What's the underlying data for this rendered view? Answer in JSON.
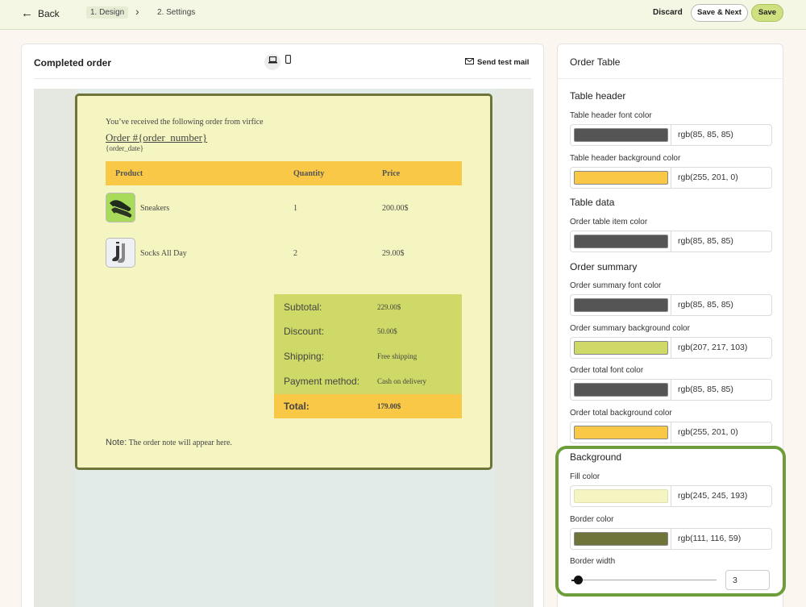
{
  "topbar": {
    "back_label": "Back",
    "step1_label": "1. Design",
    "step2_label": "2. Settings",
    "discard_label": "Discard",
    "save_next_label": "Save & Next",
    "save_label": "Save"
  },
  "preview": {
    "title": "Completed order",
    "send_test_label": "Send test mail"
  },
  "email": {
    "intro": "You’ve received the following order from virfice",
    "order_number": "Order #{order_number}",
    "order_date": "{order_date}",
    "table_headers": {
      "product": "Product",
      "quantity": "Quantity",
      "price": "Price"
    },
    "items": [
      {
        "name": "Sneakers",
        "qty": "1",
        "price": "200.00$"
      },
      {
        "name": "Socks All Day",
        "qty": "2",
        "price": "29.00$"
      }
    ],
    "summary": [
      {
        "label": "Subtotal:",
        "value": "229.00$"
      },
      {
        "label": "Discount:",
        "value": "50.00$"
      },
      {
        "label": "Shipping:",
        "value": "Free shipping"
      },
      {
        "label": "Payment method:",
        "value": "Cash on delivery"
      }
    ],
    "total_label": "Total:",
    "total_value": "179.00$",
    "note_label": "Note:",
    "note_text": " The order note will appear here."
  },
  "panel": {
    "title": "Order Table",
    "sections": {
      "table_header": "Table header",
      "table_data": "Table data",
      "order_summary": "Order summary",
      "background": "Background"
    },
    "fields": {
      "th_font": {
        "label": "Table header font color",
        "value": "rgb(85, 85, 85)",
        "color": "#555555"
      },
      "th_bg": {
        "label": "Table header background color",
        "value": "rgb(255, 201, 0)",
        "color": "#f8c846"
      },
      "item_color": {
        "label": "Order table item color",
        "value": "rgb(85, 85, 85)",
        "color": "#555555"
      },
      "sum_font": {
        "label": "Order summary font color",
        "value": "rgb(85, 85, 85)",
        "color": "#555555"
      },
      "sum_bg": {
        "label": "Order summary background color",
        "value": "rgb(207, 217, 103)",
        "color": "#cfd967"
      },
      "total_font": {
        "label": "Order total font color",
        "value": "rgb(85, 85, 85)",
        "color": "#555555"
      },
      "total_bg": {
        "label": "Order total background color",
        "value": "rgb(255, 201, 0)",
        "color": "#f8c846"
      },
      "fill": {
        "label": "Fill color",
        "value": "rgb(245, 245, 193)",
        "color": "#f5f5c1"
      },
      "border": {
        "label": "Border color",
        "value": "rgb(111, 116, 59)",
        "color": "#6f743b"
      }
    },
    "border_width_label": "Border width",
    "border_width_value": "3"
  }
}
